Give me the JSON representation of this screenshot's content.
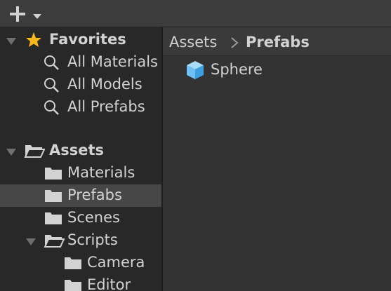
{
  "colors": {
    "panel_bg": "#282828",
    "toolbar_bg": "#3c3c3c",
    "text": "#d2d2d2",
    "selection": "#474747",
    "star": "#f5b719",
    "prefab_cube": "#6fc1f3"
  },
  "toolbar": {
    "create_button_icon": "plus-icon",
    "create_dropdown_icon": "caret-down-icon"
  },
  "favorites": {
    "label": "Favorites",
    "icon": "star-icon",
    "items": [
      {
        "label": "All Materials",
        "icon": "search-icon"
      },
      {
        "label": "All Models",
        "icon": "search-icon"
      },
      {
        "label": "All Prefabs",
        "icon": "search-icon"
      }
    ]
  },
  "assets": {
    "label": "Assets",
    "icon": "folder-open-icon",
    "items": [
      {
        "label": "Materials",
        "icon": "folder-icon"
      },
      {
        "label": "Prefabs",
        "icon": "folder-icon",
        "selected": true
      },
      {
        "label": "Scenes",
        "icon": "folder-icon"
      },
      {
        "label": "Scripts",
        "icon": "folder-open-icon",
        "expanded": true,
        "children": [
          {
            "label": "Camera",
            "icon": "folder-icon"
          },
          {
            "label": "Editor",
            "icon": "folder-icon"
          }
        ]
      }
    ]
  },
  "breadcrumb": {
    "items": [
      "Assets",
      "Prefabs"
    ],
    "separator_icon": "chevron-right-icon"
  },
  "content": {
    "items": [
      {
        "label": "Sphere",
        "icon": "prefab-cube-icon"
      }
    ]
  }
}
